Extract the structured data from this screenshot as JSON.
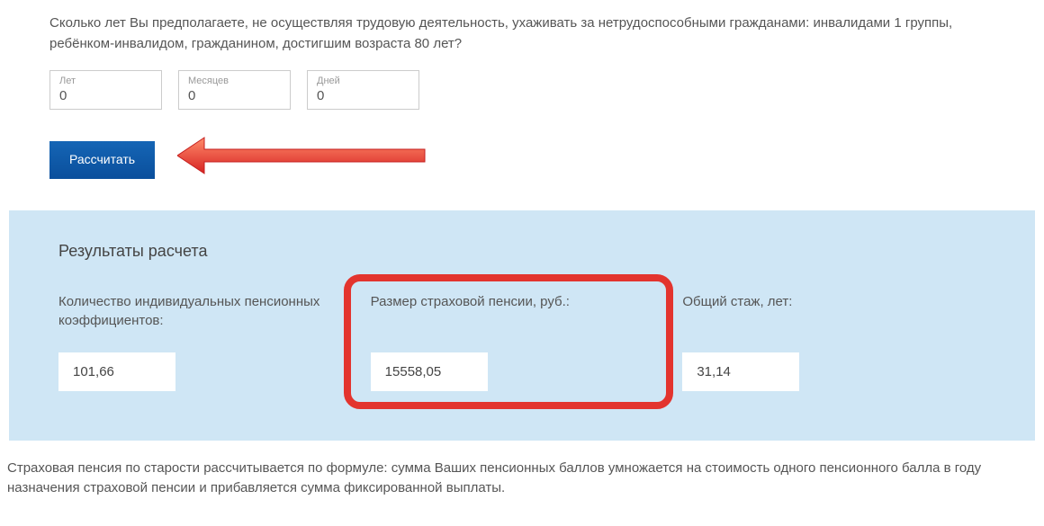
{
  "question": "Сколько лет Вы предполагаете, не осуществляя трудовую деятельность, ухаживать за нетрудоспособными гражданами: инвалидами 1 группы, ребёнком-инвалидом, гражданином, достигшим возраста 80 лет?",
  "inputs": {
    "years": {
      "label": "Лет",
      "value": "0"
    },
    "months": {
      "label": "Месяцев",
      "value": "0"
    },
    "days": {
      "label": "Дней",
      "value": "0"
    }
  },
  "button": {
    "label": "Рассчитать"
  },
  "results": {
    "title": "Результаты расчета",
    "points": {
      "label": "Количество индивидуальных пенсионных коэффициентов:",
      "value": "101,66"
    },
    "pension": {
      "label": "Размер страховой пенсии, руб.:",
      "value": "15558,05"
    },
    "stage": {
      "label": "Общий стаж, лет:",
      "value": "31,14"
    }
  },
  "footer": "Страховая пенсия по старости рассчитывается по формуле: сумма Ваших пенсионных баллов умножается на стоимость одного пенсионного балла в году назначения страховой пенсии и прибавляется сумма фиксированной выплаты."
}
